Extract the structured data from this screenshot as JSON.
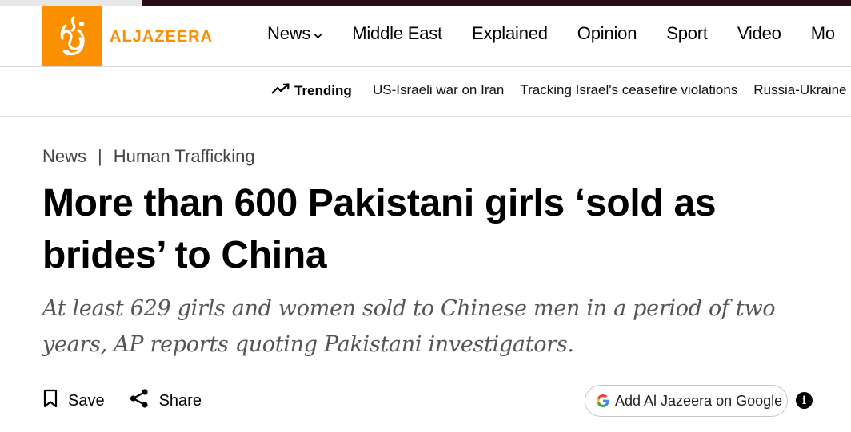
{
  "brand": {
    "name": "ALJAZEERA",
    "accent": "#fa9000",
    "dark_strip": "#2b0b1a"
  },
  "nav": {
    "items": [
      {
        "label": "News",
        "has_dropdown": true
      },
      {
        "label": "Middle East"
      },
      {
        "label": "Explained"
      },
      {
        "label": "Opinion"
      },
      {
        "label": "Sport"
      },
      {
        "label": "Video"
      },
      {
        "label": "Mo"
      }
    ]
  },
  "trending": {
    "label": "Trending",
    "links": [
      "US-Israeli war on Iran",
      "Tracking Israel's ceasefire violations",
      "Russia-Ukraine"
    ]
  },
  "breadcrumb": {
    "section": "News",
    "separator": "|",
    "topic": "Human Trafficking"
  },
  "article": {
    "headline": "More than 600 Pakistani girls ‘sold as brides’ to China",
    "subhead": "At least 629 girls and women sold to Chinese men in a period of two years, AP reports quoting Pakistani investigators."
  },
  "actions": {
    "save_label": "Save",
    "share_label": "Share"
  },
  "google_button": {
    "label": "Add Al Jazeera on Google",
    "icon": "google-g-icon"
  },
  "info_icon": {
    "glyph": "i"
  }
}
